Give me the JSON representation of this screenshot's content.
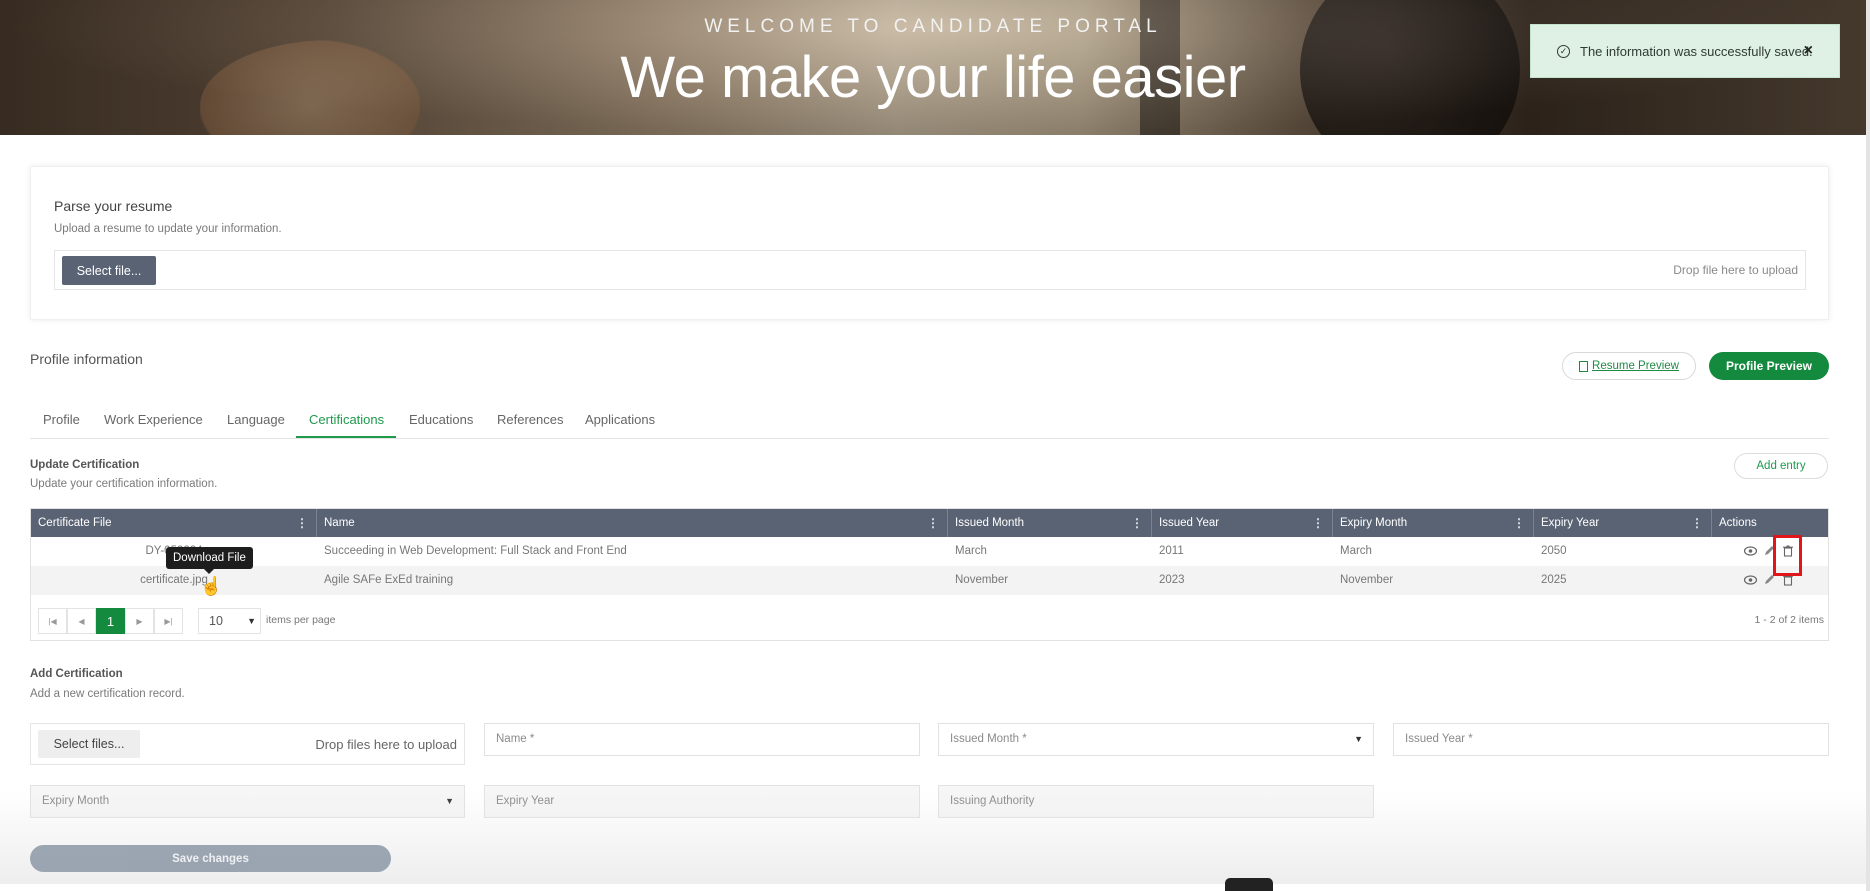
{
  "hero": {
    "subtitle": "WELCOME TO CANDIDATE PORTAL",
    "title": "We make your life easier"
  },
  "toast": {
    "message": "The information was successfully saved.",
    "close_label": "×",
    "icon": "check-circle-icon"
  },
  "resume": {
    "title": "Parse your resume",
    "subtitle": "Upload a resume to update your information.",
    "select_label": "Select file...",
    "drop_hint": "Drop file here to upload"
  },
  "profile": {
    "title": "Profile information",
    "resume_preview": "Resume Preview",
    "profile_preview": "Profile Preview"
  },
  "tabs": [
    "Profile",
    "Work Experience",
    "Language",
    "Certifications",
    "Educations",
    "References",
    "Applications"
  ],
  "active_tab": "Certifications",
  "update": {
    "title": "Update Certification",
    "subtitle": "Update your certification information.",
    "add_entry": "Add entry"
  },
  "grid": {
    "headers": [
      "Certificate File",
      "Name",
      "Issued Month",
      "Issued Year",
      "Expiry Month",
      "Expiry Year",
      "Actions"
    ],
    "rows": [
      {
        "file": "DY-052224",
        "name": "Succeeding in Web Development: Full Stack and Front End",
        "issued_month": "March",
        "issued_year": "2011",
        "expiry_month": "March",
        "expiry_year": "2050"
      },
      {
        "file": "certificate.jpg",
        "name": "Agile SAFe ExEd training",
        "issued_month": "November",
        "issued_year": "2023",
        "expiry_month": "November",
        "expiry_year": "2025"
      }
    ],
    "tooltip": "Download File",
    "pager": {
      "current_page": "1",
      "page_size": "10",
      "items_per_page_label": "items per page",
      "info": "1 - 2 of 2 items"
    }
  },
  "add": {
    "title": "Add Certification",
    "subtitle": "Add a new certification record.",
    "select_files": "Select files...",
    "drop_hint": "Drop files here to upload",
    "name_placeholder": "Name *",
    "issued_month_placeholder": "Issued Month *",
    "issued_year_placeholder": "Issued Year *",
    "expiry_month_placeholder": "Expiry Month",
    "expiry_year_placeholder": "Expiry Year",
    "issuing_authority_placeholder": "Issuing Authority"
  },
  "save_label": "Save changes",
  "colors": {
    "brand_green": "#138a3e",
    "grid_header": "#5a6374",
    "toast_bg": "#dff1e4",
    "highlight_red": "#e0161b"
  }
}
